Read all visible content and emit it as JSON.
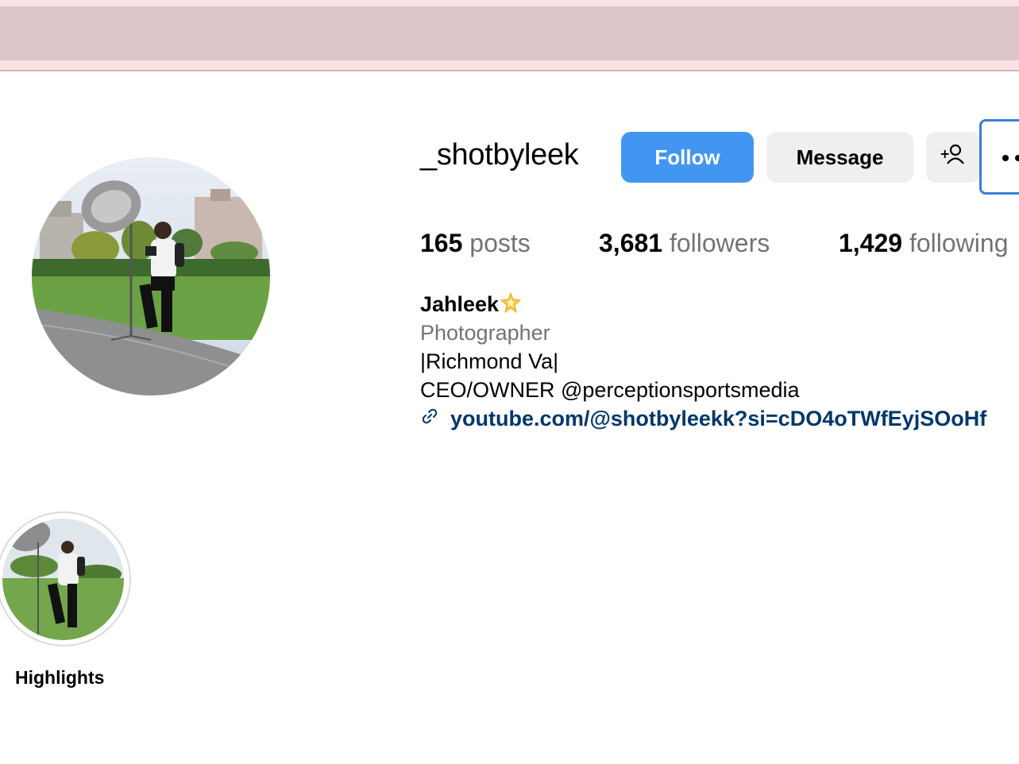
{
  "profile": {
    "username": "_shotbyleek",
    "follow_label": "Follow",
    "message_label": "Message",
    "suggest_icon": "add-person-icon",
    "more_icon": "more-horizontal-icon"
  },
  "stats": {
    "posts_count": "165",
    "posts_label": "posts",
    "followers_count": "3,681",
    "followers_label": "followers",
    "following_count": "1,429",
    "following_label": "following"
  },
  "bio": {
    "name": "Jahleek",
    "name_emoji_icon": "glowing-star-icon",
    "category": "Photographer",
    "line1": "|Richmond Va|",
    "line2": "CEO/OWNER @perceptionsportsmedia",
    "link_icon": "link-icon",
    "link": "youtube.com/@shotbyleekk?si=cDO4oTWfEyjSOoHf"
  },
  "highlights": [
    {
      "label": "Highlights"
    }
  ],
  "colors": {
    "follow_button": "#4395f2",
    "secondary_button": "#efefef",
    "link": "#00376b",
    "muted_text": "#737373",
    "banner": "#dcc6ca",
    "banner_edge": "#fbe0e4"
  }
}
